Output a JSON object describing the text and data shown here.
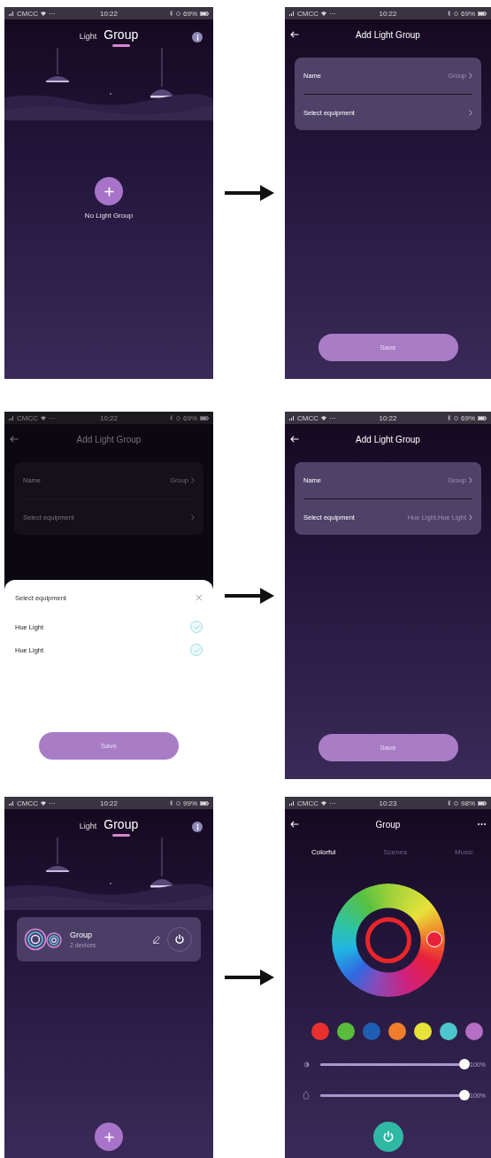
{
  "steps": [
    {
      "from": {
        "kind": "group_home",
        "status": {
          "carrier": "CMCC",
          "network": "···",
          "time": "10:22",
          "battery": "69%"
        },
        "tabs": [
          {
            "label": "Light",
            "selected": false
          },
          {
            "label": "Group",
            "selected": true
          }
        ],
        "empty_label": "No Light Group"
      },
      "to": {
        "kind": "add_group",
        "dimmed": false,
        "status": {
          "carrier": "CMCC",
          "network": "···",
          "time": "10:22",
          "battery": "69%"
        },
        "title": "Add Light Group",
        "fields": [
          {
            "label": "Name",
            "value": "Group"
          },
          {
            "label": "Select equipment"
          }
        ],
        "save": "Save"
      }
    },
    {
      "from": {
        "kind": "add_group",
        "dimmed": true,
        "status": {
          "carrier": "CMCC",
          "network": "···",
          "time": "10:22",
          "battery": "69%"
        },
        "title": "Add Light Group",
        "fields": [
          {
            "label": "Name",
            "value": "Group"
          },
          {
            "label": "Select equipment"
          }
        ],
        "sheet": {
          "title": "Select equipment",
          "items": [
            {
              "label": "Hue Light",
              "checked": true
            },
            {
              "label": "Hue Light",
              "checked": true
            }
          ],
          "save": "Save"
        }
      },
      "to": {
        "kind": "add_group",
        "dimmed": false,
        "status": {
          "carrier": "CMCC",
          "network": "···",
          "time": "10:22",
          "battery": "69%"
        },
        "title": "Add Light Group",
        "fields": [
          {
            "label": "Name",
            "value": "Group"
          },
          {
            "label": "Select equipment",
            "value": "Hue Light,Hue Light"
          }
        ],
        "save": "Save"
      }
    },
    {
      "from": {
        "kind": "group_home",
        "status": {
          "carrier": "CMCC",
          "network": "···",
          "time": "10:22",
          "battery": "99%"
        },
        "tabs": [
          {
            "label": "Light",
            "selected": false
          },
          {
            "label": "Group",
            "selected": true
          }
        ],
        "groups": [
          {
            "name": "Group",
            "detail": "2 devices"
          }
        ]
      },
      "to": {
        "kind": "color_control",
        "status": {
          "carrier": "CMCC",
          "network": "···",
          "time": "10:23",
          "battery": "98%"
        },
        "title": "Group",
        "tabs": [
          {
            "label": "Colorful",
            "selected": true
          },
          {
            "label": "Scenes",
            "selected": false
          },
          {
            "label": "Music",
            "selected": false
          }
        ],
        "swatches": [
          {
            "color": "#e8312e"
          },
          {
            "color": "#5bbb3c"
          },
          {
            "color": "#1e5fb4"
          },
          {
            "color": "#f07d2a"
          },
          {
            "color": "#e6e23a"
          },
          {
            "color": "#4cc6cc"
          },
          {
            "color": "#b46ec4"
          }
        ],
        "sliders": [
          {
            "kind": "brightness",
            "level": 1,
            "reading": "100%"
          },
          {
            "kind": "saturation",
            "level": 1,
            "reading": "100%"
          }
        ]
      }
    }
  ]
}
